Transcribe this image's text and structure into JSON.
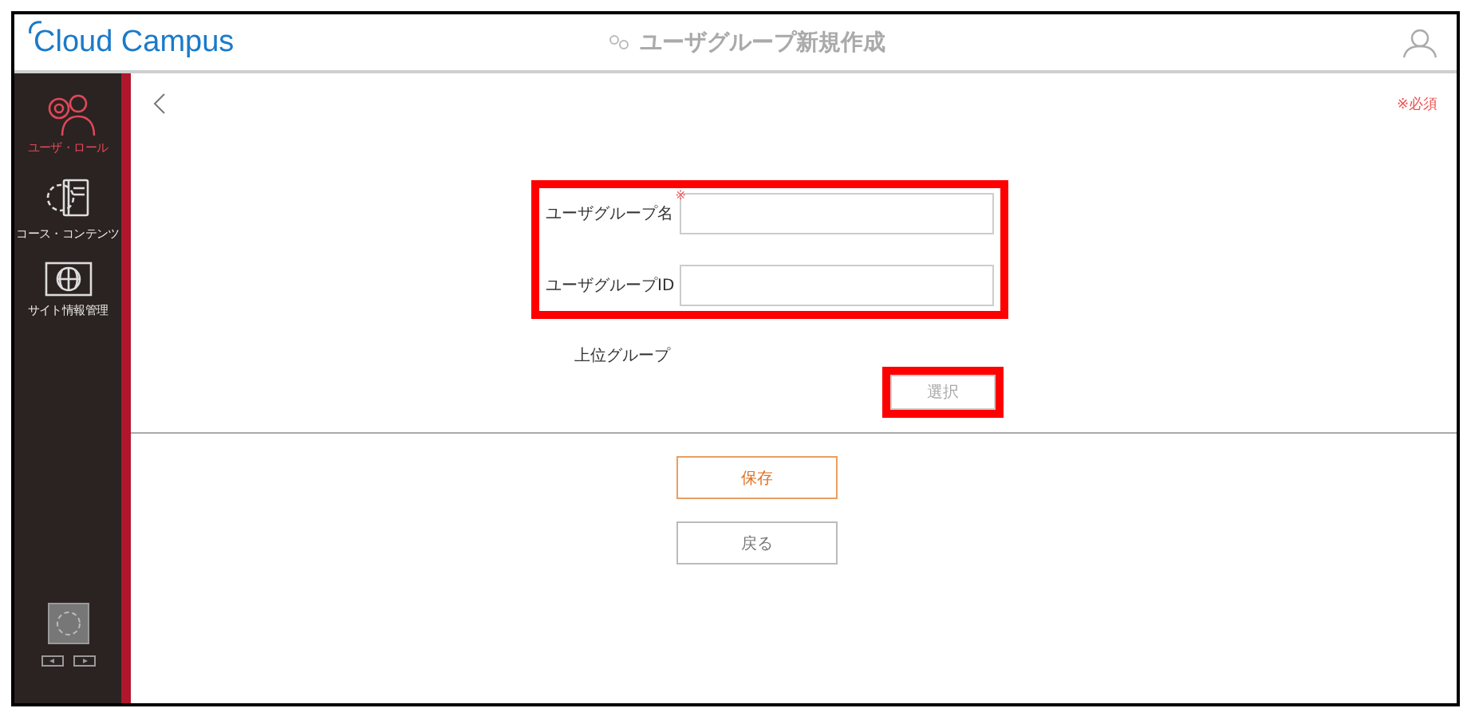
{
  "header": {
    "logo": "Cloud Campus",
    "title": "ユーザグループ新規作成"
  },
  "sidebar": {
    "items": [
      {
        "label": "ユーザ・ロール",
        "selected": true,
        "kind": "users"
      },
      {
        "label": "コース・コンテンツ",
        "selected": false,
        "kind": "book"
      },
      {
        "label": "サイト情報管理",
        "selected": false,
        "kind": "globe"
      }
    ]
  },
  "required_note": "※必須",
  "form": {
    "fields": [
      {
        "label": "ユーザグループ名",
        "required_mark": "※"
      },
      {
        "label": "ユーザグループID"
      }
    ],
    "parent_group": {
      "label": "上位グループ",
      "button": "選択"
    }
  },
  "buttons": [
    {
      "label": "保存",
      "kind": "primary"
    },
    {
      "label": "戻る",
      "kind": "secondary"
    }
  ]
}
